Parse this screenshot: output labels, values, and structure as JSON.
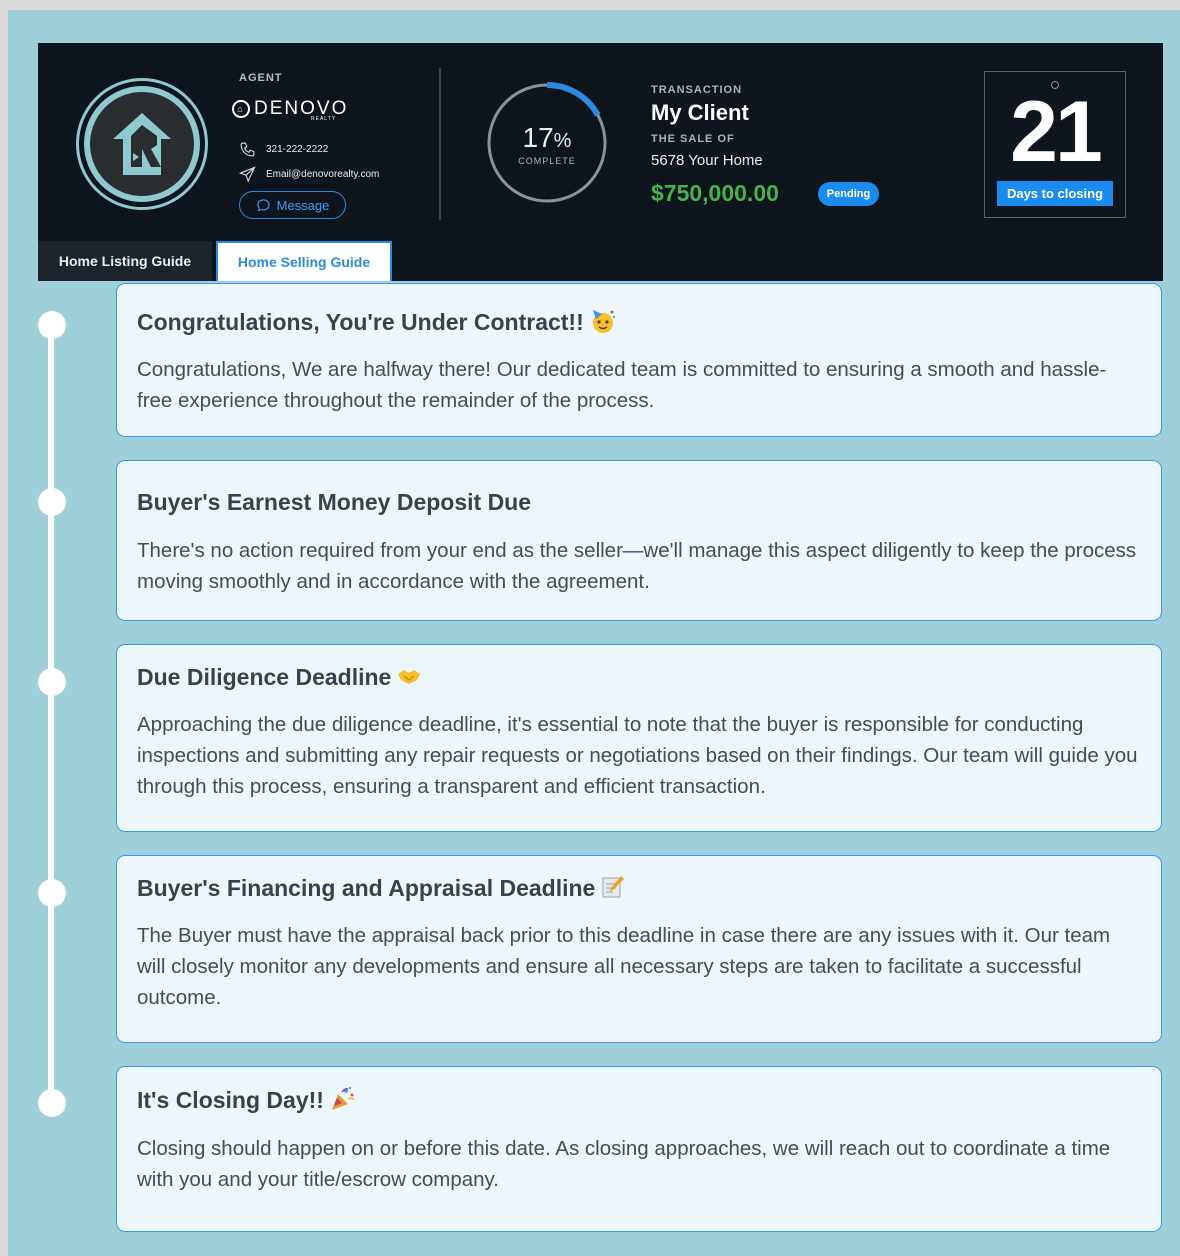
{
  "header": {
    "agent_label": "AGENT",
    "brand_name": "DENOVO",
    "brand_sub": "REALTY",
    "phone": "321-222-2222",
    "email": "Email@denovorealty.com",
    "message_button": "Message",
    "progress": {
      "percent": 17,
      "number": "17",
      "unit": "%",
      "label": "COMPLETE"
    },
    "transaction_label": "TRANSACTION",
    "client": "My Client",
    "sale_label": "THE SALE OF",
    "home": "5678 Your Home",
    "price": "$750,000.00",
    "status": "Pending",
    "days": "21",
    "days_label": "Days to closing"
  },
  "tabs": [
    {
      "label": "Home Listing Guide",
      "active": false
    },
    {
      "label": "Home Selling Guide",
      "active": true
    }
  ],
  "timeline": [
    {
      "title": "Congratulations, You're Under Contract!!",
      "emoji": "party-face-icon",
      "body": "Congratulations, We are halfway there! Our dedicated team is committed to ensuring a smooth and hassle-free experience throughout the remainder of the process."
    },
    {
      "title": "Buyer's Earnest Money Deposit Due",
      "emoji": "",
      "body": "There's no action required from your end as the seller—we'll manage this aspect diligently to keep the process moving smoothly and in accordance with the agreement."
    },
    {
      "title": "Due Diligence Deadline",
      "emoji": "handshake-icon",
      "body": "Approaching the due diligence deadline, it's essential to note that the buyer is responsible for conducting inspections and submitting any repair requests or negotiations based on their findings. Our team will guide you through this process, ensuring a transparent and efficient transaction."
    },
    {
      "title": "Buyer's Financing and Appraisal Deadline",
      "emoji": "memo-icon",
      "body": " The Buyer must have the appraisal back prior to this deadline in case there are any issues with it. Our team will closely monitor any developments and ensure all necessary steps are taken to facilitate a successful outcome."
    },
    {
      "title": "It's Closing Day!!",
      "emoji": "party-popper-icon",
      "body": "Closing should happen on or before this date. As closing approaches, we will reach out to coordinate a time with you and your title/escrow company."
    }
  ],
  "colors": {
    "background": "#9fd0d9",
    "header": "#0f151d",
    "accent": "#1a8cf0",
    "price": "#43b54a",
    "card_bg": "#eef6fd",
    "card_border": "#3a9ae8"
  }
}
